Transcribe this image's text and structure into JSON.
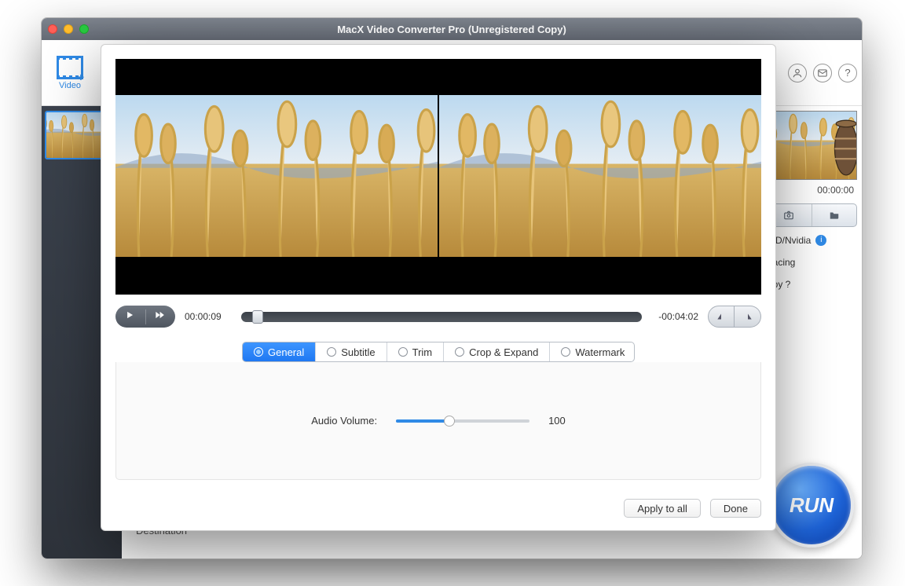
{
  "window": {
    "title": "MacX Video Converter Pro (Unregistered Copy)"
  },
  "toolbar": {
    "video_label": "Video"
  },
  "sidebar": {},
  "right": {
    "preview_time": "00:00:00",
    "opt_hw": "MD/Nvidia",
    "opt_deint": "rlacing",
    "opt_copy": "opy ?"
  },
  "run_label": "RUN",
  "destination_label": "Destination",
  "editor": {
    "elapsed": "00:00:09",
    "remaining": "-00:04:02",
    "tabs": {
      "general": "General",
      "subtitle": "Subtitle",
      "trim": "Trim",
      "crop": "Crop & Expand",
      "watermark": "Watermark"
    },
    "audio_label": "Audio Volume:",
    "audio_value": "100",
    "apply_all": "Apply to all",
    "done": "Done"
  }
}
